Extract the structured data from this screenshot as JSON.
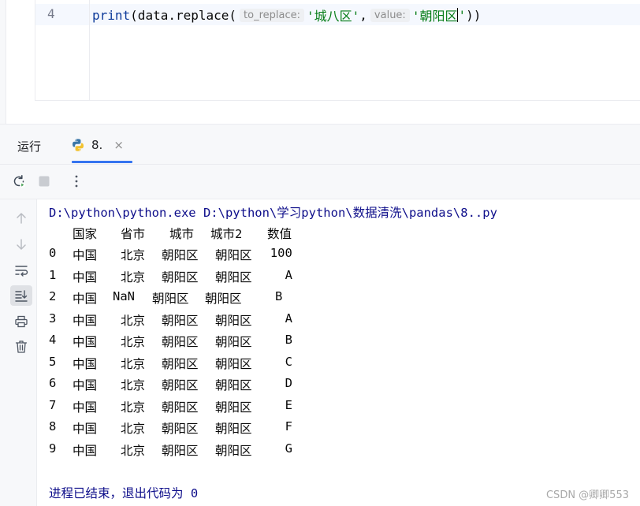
{
  "editor": {
    "line_number": "4",
    "code": {
      "fn": "print",
      "open": "(data.replace(",
      "hint1": "to_replace:",
      "arg1": "'城八区'",
      "comma": ",",
      "hint2": "value:",
      "arg2_text": "'朝阳区",
      "arg2_quote": "'",
      "close": "))"
    }
  },
  "panel": {
    "run_label": "运行",
    "tab_label": "8.",
    "tab_close": "×",
    "icons": {
      "rerun": "rerun-icon",
      "stop": "stop-icon",
      "more": "more-vertical-icon",
      "up": "arrow-up-icon",
      "down": "arrow-down-icon",
      "soft_wrap": "soft-wrap-icon",
      "scroll_end": "scroll-to-end-icon",
      "print": "print-icon",
      "trash": "trash-icon"
    }
  },
  "console": {
    "command": "D:\\python\\python.exe D:\\python\\学习python\\数据清洗\\pandas\\8..py",
    "headers": [
      "国家",
      "省市",
      "城市",
      "城市2",
      "数值"
    ],
    "rows": [
      [
        "0",
        "中国",
        "北京",
        "朝阳区",
        "朝阳区",
        "100"
      ],
      [
        "1",
        "中国",
        "北京",
        "朝阳区",
        "朝阳区",
        "A"
      ],
      [
        "2",
        "中国",
        "NaN",
        "朝阳区",
        "朝阳区",
        "B"
      ],
      [
        "3",
        "中国",
        "北京",
        "朝阳区",
        "朝阳区",
        "A"
      ],
      [
        "4",
        "中国",
        "北京",
        "朝阳区",
        "朝阳区",
        "B"
      ],
      [
        "5",
        "中国",
        "北京",
        "朝阳区",
        "朝阳区",
        "C"
      ],
      [
        "6",
        "中国",
        "北京",
        "朝阳区",
        "朝阳区",
        "D"
      ],
      [
        "7",
        "中国",
        "北京",
        "朝阳区",
        "朝阳区",
        "E"
      ],
      [
        "8",
        "中国",
        "北京",
        "朝阳区",
        "朝阳区",
        "F"
      ],
      [
        "9",
        "中国",
        "北京",
        "朝阳区",
        "朝阳区",
        "G"
      ]
    ],
    "exit_message": "进程已结束，退出代码为 0"
  },
  "watermark": "CSDN @卿卿553",
  "colors": {
    "accent": "#3574f0",
    "string": "#067d17",
    "function": "#0d3a9a",
    "console_blue": "#0d0d8a"
  }
}
